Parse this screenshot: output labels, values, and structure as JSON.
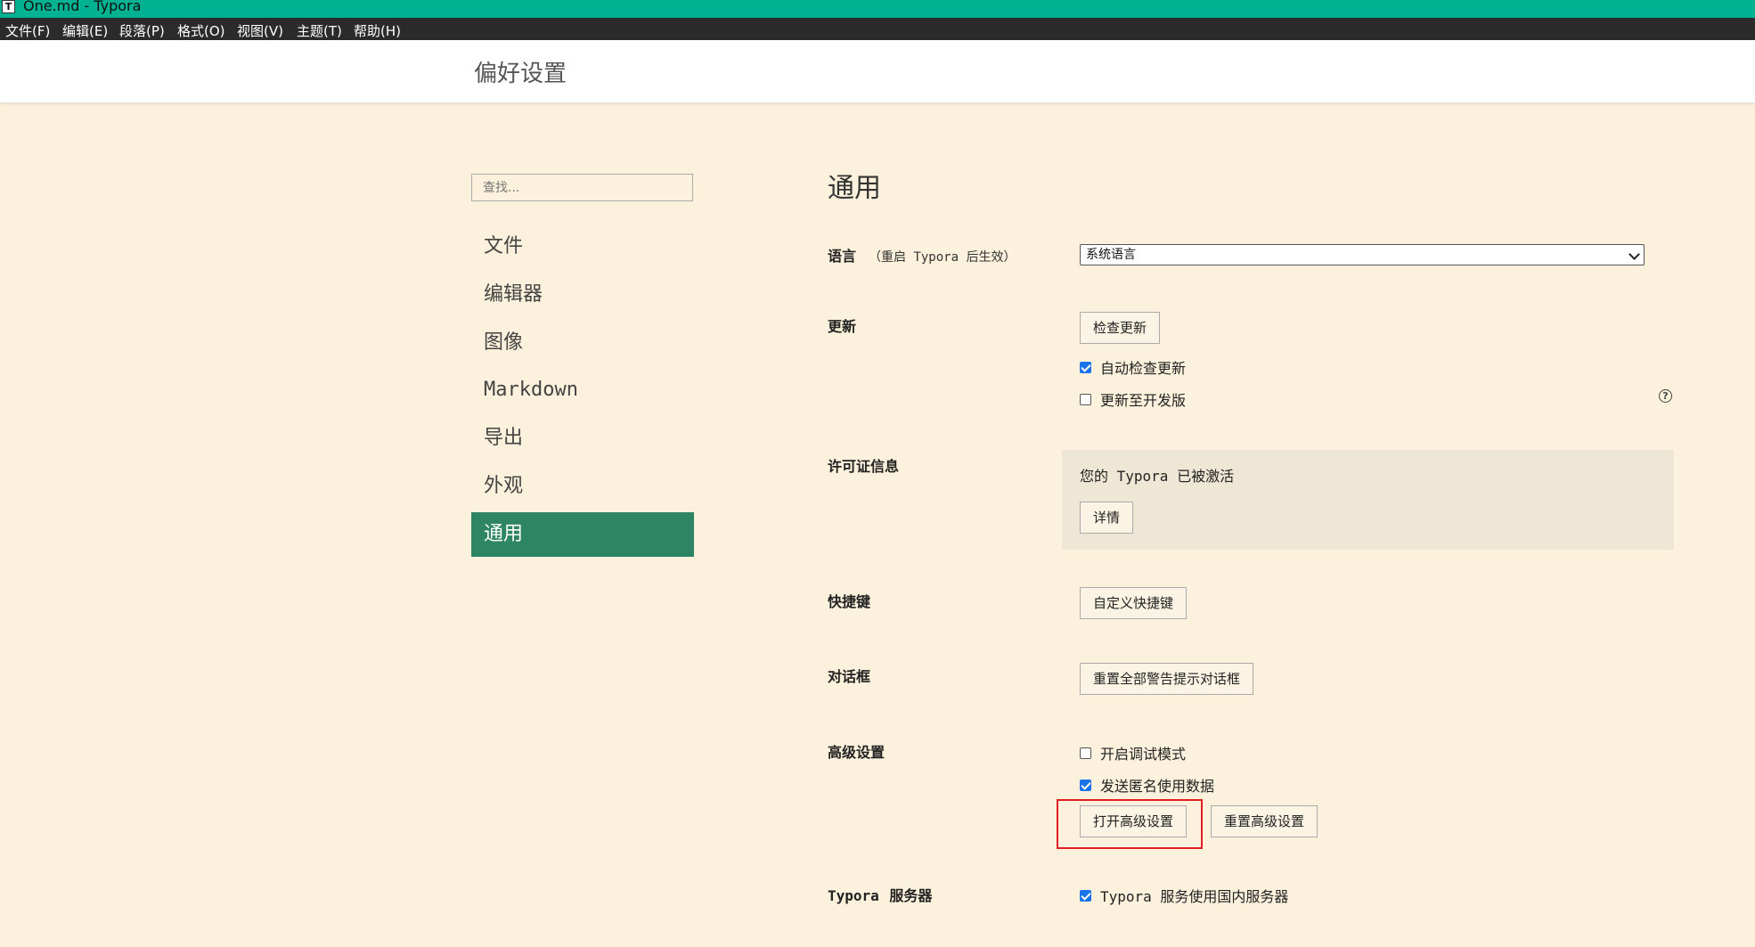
{
  "window": {
    "title": "One.md - Typora",
    "app_icon_letter": "T",
    "accent_color": "#00b292"
  },
  "menu": [
    "文件(F)",
    "编辑(E)",
    "段落(P)",
    "格式(O)",
    "视图(V)",
    "主题(T)",
    "帮助(H)"
  ],
  "header": {
    "title": "偏好设置"
  },
  "sidebar": {
    "search_placeholder": "查找...",
    "items": [
      "文件",
      "编辑器",
      "图像",
      "Markdown",
      "导出",
      "外观",
      "通用"
    ],
    "active_item": "通用",
    "active_color": "#2e8563"
  },
  "main": {
    "heading": "通用",
    "language": {
      "label": "语言",
      "hint": "（重启 Typora 后生效）",
      "selected": "系统语言"
    },
    "update": {
      "label": "更新",
      "check_button": "检查更新",
      "auto_check": {
        "label": "自动检查更新",
        "checked": true
      },
      "dev_channel": {
        "label": "更新至开发版",
        "checked": false
      },
      "help_icon": "?"
    },
    "license": {
      "label": "许可证信息",
      "status_text": "您的 Typora 已被激活",
      "details_button": "详情"
    },
    "shortcuts": {
      "label": "快捷键",
      "button": "自定义快捷键"
    },
    "dialogs": {
      "label": "对话框",
      "button": "重置全部警告提示对话框"
    },
    "advanced": {
      "label": "高级设置",
      "debug_mode": {
        "label": "开启调试模式",
        "checked": false
      },
      "send_usage": {
        "label": "发送匿名使用数据",
        "checked": true
      },
      "open_button": "打开高级设置",
      "reset_button": "重置高级设置"
    },
    "server": {
      "label_prefix": "Typora",
      "label_suffix": "服务器",
      "use_domestic": {
        "label": "Typora 服务使用国内服务器",
        "checked": true
      }
    }
  }
}
